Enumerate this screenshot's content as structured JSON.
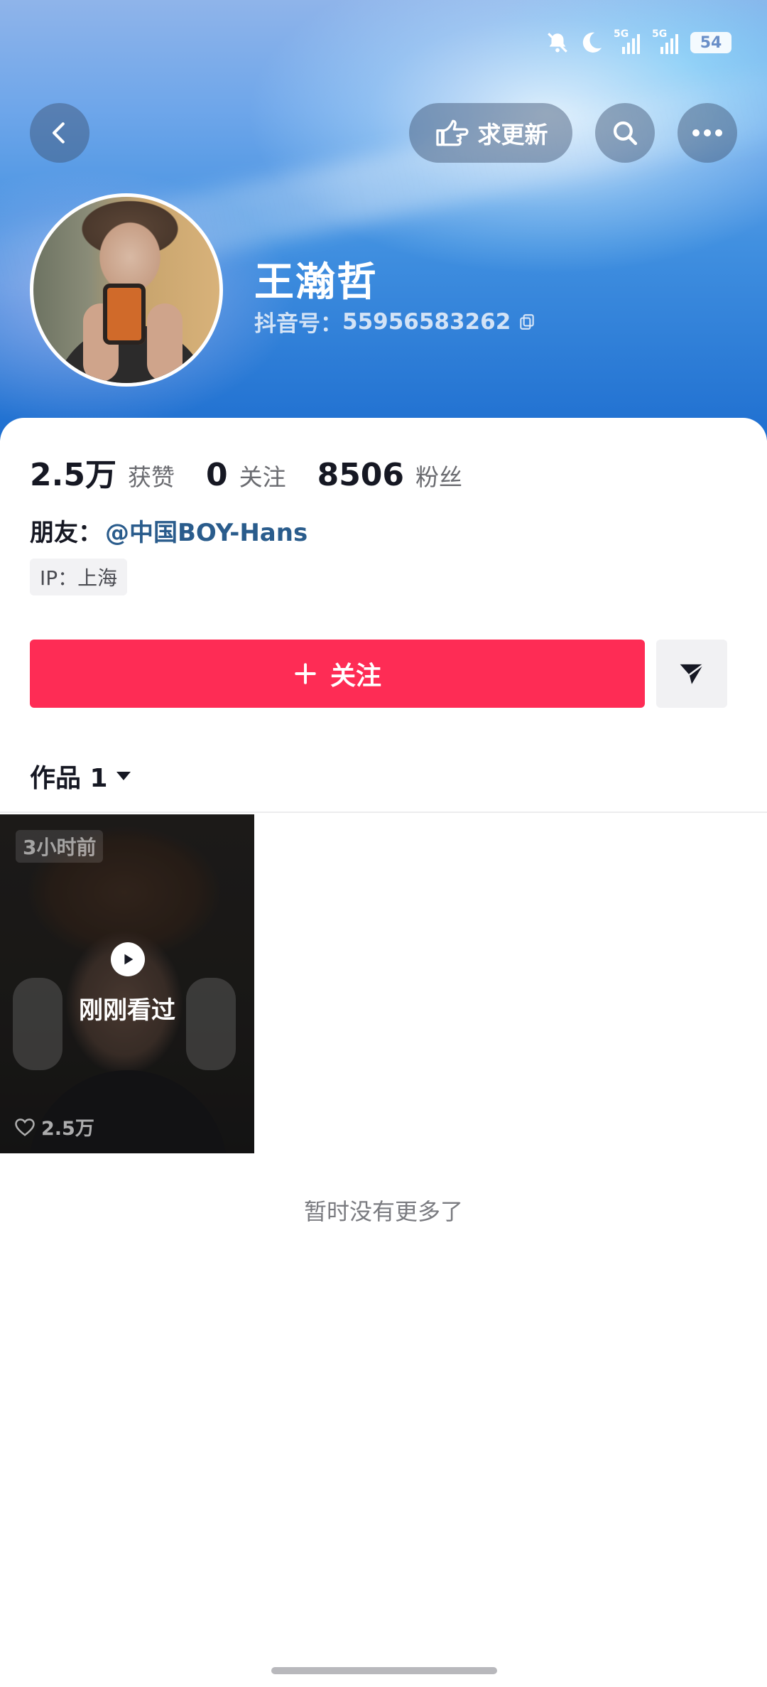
{
  "status_bar": {
    "network_1": "5G",
    "network_2": "5G",
    "battery": "54"
  },
  "header": {
    "request_update_label": "求更新",
    "name": "王瀚哲",
    "account_prefix": "抖音号：",
    "account_id": "55956583262"
  },
  "stats": [
    {
      "value": "2.5万",
      "label": "获赞"
    },
    {
      "value": "0",
      "label": "关注"
    },
    {
      "value": "8506",
      "label": "粉丝"
    }
  ],
  "friend": {
    "prefix": "朋友：",
    "link": "@中国BOY-Hans"
  },
  "ip": "IP：上海",
  "follow_label": "关注",
  "works_tab": "作品 1",
  "videos": [
    {
      "time": "3小时前",
      "overlay": "刚刚看过",
      "likes": "2.5万"
    }
  ],
  "footer_text": "暂时没有更多了",
  "colors": {
    "follow_red": "#fe2c55",
    "link_blue": "#2a5c8c"
  }
}
